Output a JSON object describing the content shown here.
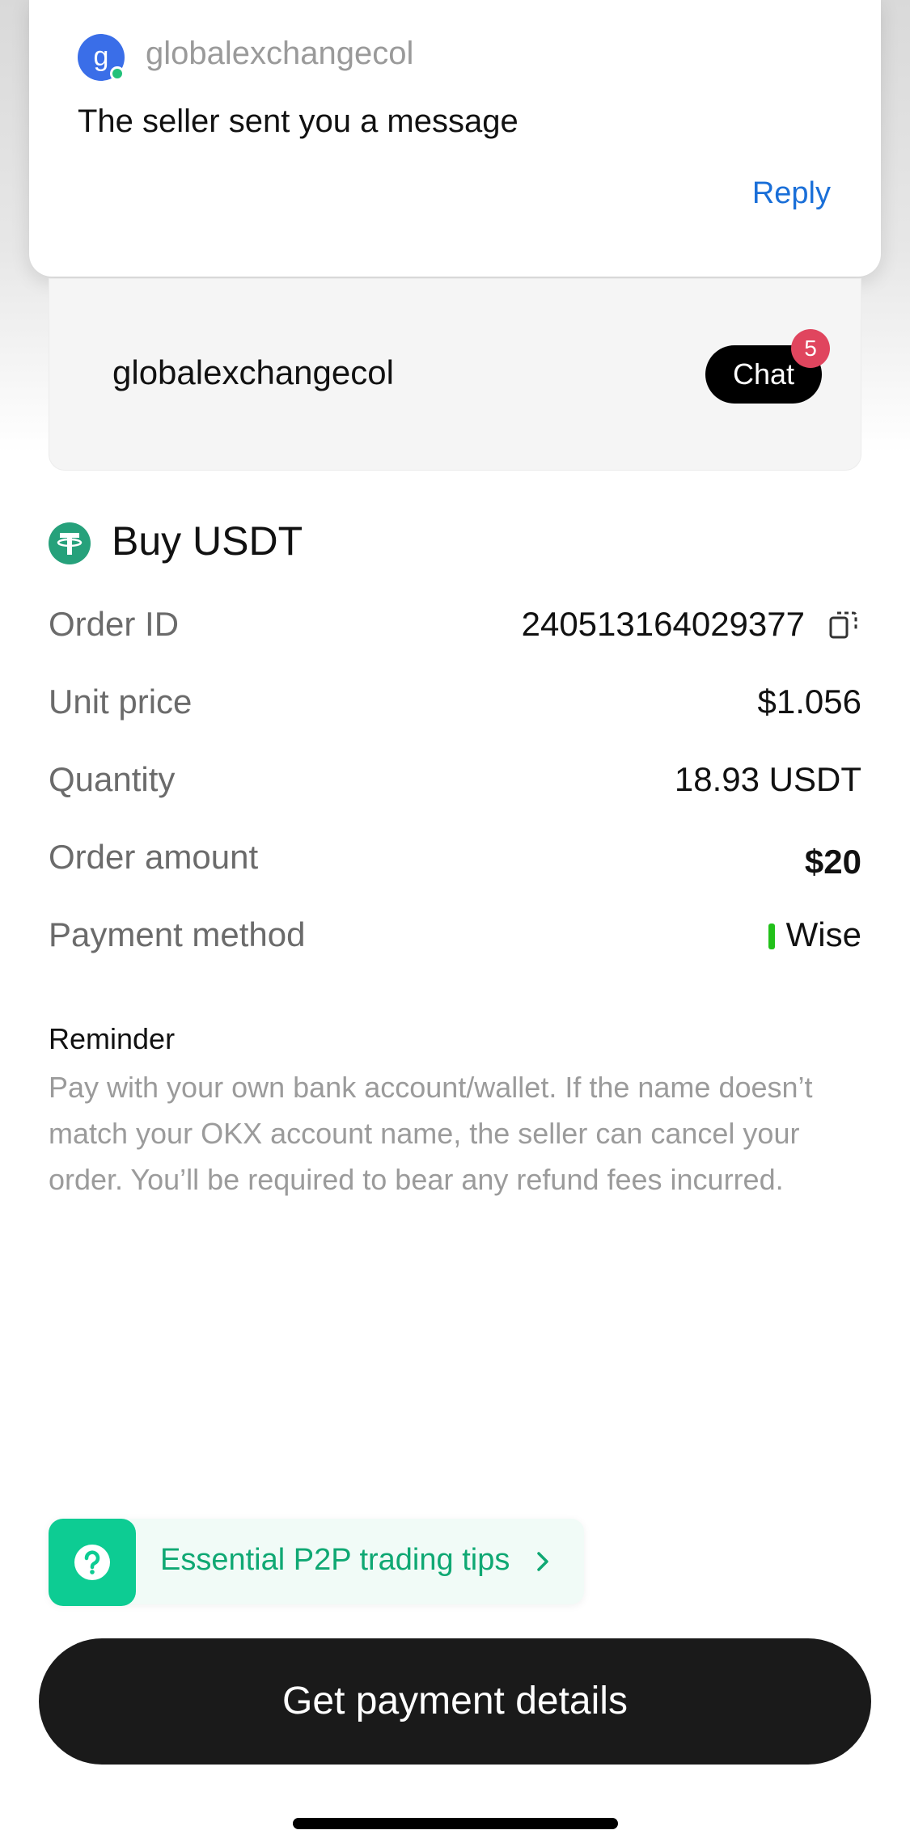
{
  "notification": {
    "avatar_letter": "g",
    "sender": "globalexchangecol",
    "message": "The seller sent you a message",
    "reply_label": "Reply"
  },
  "seller": {
    "name": "globalexchangecol",
    "chat_label": "Chat",
    "chat_badge": "5"
  },
  "order": {
    "title": "Buy USDT",
    "rows": [
      {
        "label": "Order ID",
        "value": "240513164029377"
      },
      {
        "label": "Unit price",
        "value": "$1.056"
      },
      {
        "label": "Quantity",
        "value": "18.93 USDT"
      },
      {
        "label": "Order amount",
        "value": "$20"
      },
      {
        "label": "Payment method",
        "value": "Wise"
      }
    ]
  },
  "reminder": {
    "title": "Reminder",
    "text": "Pay with your own bank account/wallet. If the name doesn’t match your OKX account name, the seller can cancel your order. You’ll be required to bear any refund fees incurred."
  },
  "tips": {
    "label": "Essential P2P trading tips"
  },
  "primary_button": {
    "label": "Get payment details"
  },
  "colors": {
    "accent_blue": "#1a6fd8",
    "tether_green": "#26a17b",
    "badge_red": "#e0455e",
    "tips_green": "#0dcc93",
    "wise_green": "#22c11a"
  },
  "icons": {
    "tether": "tether-icon",
    "copy": "copy-icon",
    "help": "question-circle-icon",
    "chevron": "chevron-right-icon"
  }
}
